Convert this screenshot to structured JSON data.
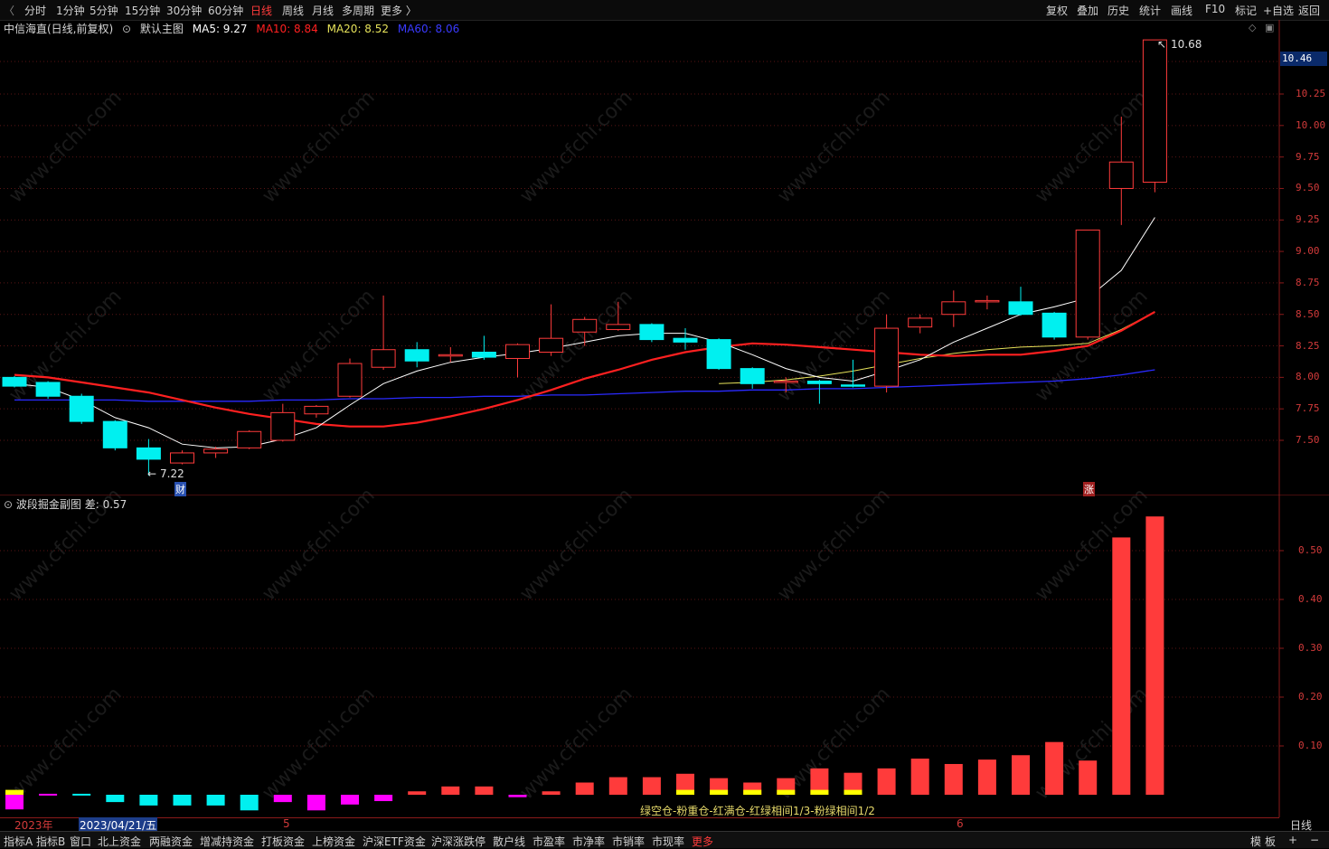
{
  "toolbar": {
    "left_items": [
      "分时",
      "1分钟",
      "5分钟",
      "15分钟",
      "30分钟",
      "60分钟",
      "日线",
      "周线",
      "月线",
      "多周期",
      "更多 〉"
    ],
    "active_item": "日线",
    "right_items": [
      "复权",
      "叠加",
      "历史",
      "统计",
      "画线",
      "F10",
      "标记",
      "+自选",
      "返回"
    ]
  },
  "main_chart": {
    "stock_name": "中信海直(日线,前复权)",
    "template": "默认主图",
    "ma5": "MA5: 9.27",
    "ma10": "MA10: 8.84",
    "ma20": "MA20: 8.52",
    "ma60": "MA60: 8.06",
    "current_price": "10.46",
    "high_label": "10.68",
    "low_label": "7.22",
    "event_fin": "财",
    "event_zhang": "涨",
    "y_ticks": [
      "10.25",
      "10.00",
      "9.75",
      "9.50",
      "9.25",
      "9.00",
      "8.75",
      "8.50",
      "8.25",
      "8.00",
      "7.75",
      "7.50"
    ]
  },
  "sub_chart": {
    "title": "波段掘金副图",
    "diff": "差: 0.57",
    "y_ticks": [
      "0.50",
      "0.40",
      "0.30",
      "0.20",
      "0.10"
    ],
    "legend": "绿空仓-粉重仓-红满仓-红绿相间1/3-粉绿相间1/2"
  },
  "date_axis": {
    "year": "2023年",
    "selected_date": "2023/04/21/五",
    "month5": "5",
    "month6": "6",
    "period": "日线"
  },
  "bottom_tabs": [
    "指标A",
    "指标B",
    "窗口",
    "北上资金",
    "两融资金",
    "增减持资金",
    "打板资金",
    "上榜资金",
    "沪深ETF资金",
    "沪深涨跌停",
    "散户线",
    "市盈率",
    "市净率",
    "市销率",
    "市现率",
    "更多"
  ],
  "bottom_right": [
    "模",
    "板",
    "+",
    "−"
  ],
  "watermark_text": "www.cfchi.com",
  "colors": {
    "up": "#ff3b3b",
    "down": "#00f0f0",
    "ma5": "#ffffff",
    "ma10": "#ff2020",
    "ma20": "#e6e25a",
    "ma60": "#2a2aff",
    "pink": "#ff00ff",
    "yellow": "#ffff00"
  },
  "chart_data": [
    {
      "type": "candlestick",
      "title": "中信海直(日线,前复权)",
      "ylim": [
        7.2,
        10.75
      ],
      "candles": [
        {
          "o": 8.0,
          "c": 7.93,
          "h": 8.01,
          "l": 7.92
        },
        {
          "o": 7.96,
          "c": 7.85,
          "h": 7.97,
          "l": 7.83
        },
        {
          "o": 7.85,
          "c": 7.65,
          "h": 7.87,
          "l": 7.63
        },
        {
          "o": 7.65,
          "c": 7.44,
          "h": 7.66,
          "l": 7.42
        },
        {
          "o": 7.44,
          "c": 7.35,
          "h": 7.51,
          "l": 7.22
        },
        {
          "o": 7.32,
          "c": 7.4,
          "h": 7.42,
          "l": 7.31
        },
        {
          "o": 7.4,
          "c": 7.43,
          "h": 7.45,
          "l": 7.36
        },
        {
          "o": 7.44,
          "c": 7.57,
          "h": 7.58,
          "l": 7.43
        },
        {
          "o": 7.5,
          "c": 7.72,
          "h": 7.79,
          "l": 7.49
        },
        {
          "o": 7.71,
          "c": 7.77,
          "h": 7.78,
          "l": 7.68
        },
        {
          "o": 7.85,
          "c": 8.11,
          "h": 8.15,
          "l": 7.84
        },
        {
          "o": 8.08,
          "c": 8.22,
          "h": 8.65,
          "l": 8.06
        },
        {
          "o": 8.22,
          "c": 8.13,
          "h": 8.28,
          "l": 8.08
        },
        {
          "o": 8.18,
          "c": 8.18,
          "h": 8.24,
          "l": 8.12
        },
        {
          "o": 8.2,
          "c": 8.16,
          "h": 8.33,
          "l": 8.14
        },
        {
          "o": 8.15,
          "c": 8.26,
          "h": 8.27,
          "l": 8.0
        },
        {
          "o": 8.2,
          "c": 8.31,
          "h": 8.58,
          "l": 8.17
        },
        {
          "o": 8.36,
          "c": 8.46,
          "h": 8.48,
          "l": 8.25
        },
        {
          "o": 8.38,
          "c": 8.42,
          "h": 8.6,
          "l": 8.37
        },
        {
          "o": 8.42,
          "c": 8.3,
          "h": 8.43,
          "l": 8.28
        },
        {
          "o": 8.31,
          "c": 8.28,
          "h": 8.39,
          "l": 8.22
        },
        {
          "o": 8.3,
          "c": 8.07,
          "h": 8.31,
          "l": 8.06
        },
        {
          "o": 8.07,
          "c": 7.95,
          "h": 8.08,
          "l": 7.91
        },
        {
          "o": 7.96,
          "c": 7.97,
          "h": 8.0,
          "l": 7.88
        },
        {
          "o": 7.97,
          "c": 7.95,
          "h": 7.98,
          "l": 7.79
        },
        {
          "o": 7.94,
          "c": 7.93,
          "h": 8.14,
          "l": 7.92
        },
        {
          "o": 7.93,
          "c": 8.39,
          "h": 8.5,
          "l": 7.88
        },
        {
          "o": 8.4,
          "c": 8.47,
          "h": 8.5,
          "l": 8.35
        },
        {
          "o": 8.5,
          "c": 8.6,
          "h": 8.69,
          "l": 8.4
        },
        {
          "o": 8.61,
          "c": 8.61,
          "h": 8.65,
          "l": 8.54
        },
        {
          "o": 8.6,
          "c": 8.5,
          "h": 8.72,
          "l": 8.49
        },
        {
          "o": 8.51,
          "c": 8.32,
          "h": 8.52,
          "l": 8.3
        },
        {
          "o": 8.32,
          "c": 9.17,
          "h": 9.17,
          "l": 8.3
        },
        {
          "o": 9.5,
          "c": 9.71,
          "h": 10.07,
          "l": 9.21
        },
        {
          "o": 9.55,
          "c": 10.68,
          "h": 10.68,
          "l": 9.47
        }
      ],
      "ma5": [
        7.95,
        7.92,
        7.82,
        7.68,
        7.6,
        7.47,
        7.44,
        7.45,
        7.51,
        7.6,
        7.78,
        7.95,
        8.05,
        8.12,
        8.16,
        8.19,
        8.23,
        8.28,
        8.33,
        8.35,
        8.35,
        8.28,
        8.18,
        8.07,
        8.0,
        7.97,
        8.05,
        8.14,
        8.28,
        8.39,
        8.5,
        8.56,
        8.63,
        8.85,
        9.27
      ],
      "ma10": [
        8.02,
        8.0,
        7.96,
        7.92,
        7.88,
        7.82,
        7.76,
        7.71,
        7.67,
        7.63,
        7.61,
        7.61,
        7.64,
        7.69,
        7.75,
        7.82,
        7.9,
        7.99,
        8.06,
        8.14,
        8.2,
        8.24,
        8.27,
        8.26,
        8.24,
        8.22,
        8.2,
        8.18,
        8.17,
        8.18,
        8.18,
        8.21,
        8.25,
        8.37,
        8.52,
        8.84
      ],
      "ma20": [
        null,
        null,
        null,
        null,
        null,
        null,
        null,
        null,
        null,
        null,
        null,
        null,
        null,
        null,
        null,
        null,
        null,
        null,
        null,
        null,
        null,
        7.95,
        7.96,
        7.98,
        8.01,
        8.05,
        8.1,
        8.15,
        8.19,
        8.22,
        8.24,
        8.25,
        8.27,
        8.38,
        8.52
      ],
      "ma60": [
        7.82,
        7.82,
        7.82,
        7.82,
        7.81,
        7.81,
        7.81,
        7.81,
        7.82,
        7.82,
        7.83,
        7.83,
        7.84,
        7.84,
        7.85,
        7.85,
        7.86,
        7.86,
        7.87,
        7.88,
        7.89,
        7.89,
        7.9,
        7.9,
        7.91,
        7.91,
        7.92,
        7.93,
        7.94,
        7.95,
        7.96,
        7.97,
        7.99,
        8.02,
        8.06
      ]
    },
    {
      "type": "bar",
      "title": "波段掘金副图",
      "ylim": [
        -0.04,
        0.58
      ],
      "bars": [
        {
          "v": -0.03,
          "c": "pink",
          "y": 0.01
        },
        {
          "v": 0.002,
          "c": "pink"
        },
        {
          "v": 0.002,
          "c": "cyan"
        },
        {
          "v": -0.015,
          "c": "cyan"
        },
        {
          "v": -0.022,
          "c": "cyan"
        },
        {
          "v": -0.022,
          "c": "cyan"
        },
        {
          "v": -0.022,
          "c": "cyan"
        },
        {
          "v": -0.032,
          "c": "cyan"
        },
        {
          "v": -0.015,
          "c": "pink"
        },
        {
          "v": -0.032,
          "c": "pink"
        },
        {
          "v": -0.02,
          "c": "pink"
        },
        {
          "v": -0.013,
          "c": "pink"
        },
        {
          "v": 0.007,
          "c": "red"
        },
        {
          "v": 0.017,
          "c": "red"
        },
        {
          "v": 0.017,
          "c": "red"
        },
        {
          "v": -0.005,
          "c": "pink"
        },
        {
          "v": 0.007,
          "c": "red"
        },
        {
          "v": 0.025,
          "c": "red"
        },
        {
          "v": 0.036,
          "c": "red"
        },
        {
          "v": 0.036,
          "c": "red"
        },
        {
          "v": 0.043,
          "c": "red",
          "y": 0.01
        },
        {
          "v": 0.034,
          "c": "red",
          "y": 0.01
        },
        {
          "v": 0.025,
          "c": "red",
          "y": 0.01
        },
        {
          "v": 0.034,
          "c": "red",
          "y": 0.01
        },
        {
          "v": 0.054,
          "c": "red",
          "y": 0.01
        },
        {
          "v": 0.045,
          "c": "red",
          "y": 0.01
        },
        {
          "v": 0.054,
          "c": "red"
        },
        {
          "v": 0.074,
          "c": "red"
        },
        {
          "v": 0.063,
          "c": "red"
        },
        {
          "v": 0.072,
          "c": "red"
        },
        {
          "v": 0.081,
          "c": "red"
        },
        {
          "v": 0.108,
          "c": "red"
        },
        {
          "v": 0.07,
          "c": "red"
        },
        {
          "v": 0.527,
          "c": "red"
        },
        {
          "v": 0.57,
          "c": "red"
        }
      ]
    }
  ]
}
